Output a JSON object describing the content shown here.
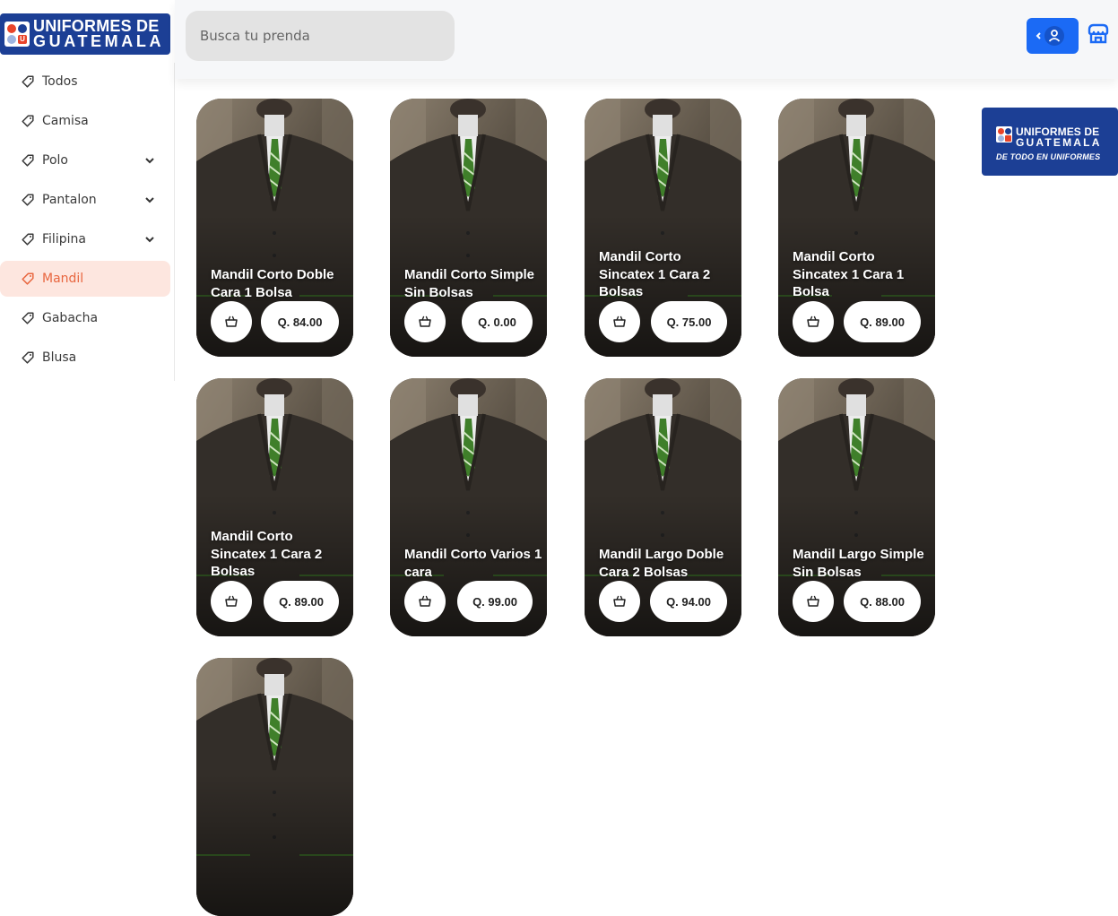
{
  "brand": {
    "line1": "UNIFORMES DE",
    "line2": "GUATEMALA",
    "mark_letter": "U"
  },
  "search": {
    "placeholder": "Busca tu prenda"
  },
  "sidebar": {
    "items": [
      {
        "label": "Todos",
        "expandable": false,
        "active": false
      },
      {
        "label": "Camisa",
        "expandable": false,
        "active": false
      },
      {
        "label": "Polo",
        "expandable": true,
        "active": false
      },
      {
        "label": "Pantalon",
        "expandable": true,
        "active": false
      },
      {
        "label": "Filipina",
        "expandable": true,
        "active": false
      },
      {
        "label": "Mandil",
        "expandable": false,
        "active": true
      },
      {
        "label": "Gabacha",
        "expandable": false,
        "active": false
      },
      {
        "label": "Blusa",
        "expandable": false,
        "active": false
      }
    ]
  },
  "header": {
    "user_icon": "user-icon",
    "store_icon": "store-icon"
  },
  "banner": {
    "line1": "UNIFORMES DE",
    "line2": "GUATEMALA",
    "tagline": "DE TODO EN UNIFORMES"
  },
  "products": [
    {
      "name": "Mandil Corto Doble Cara 1 Bolsa",
      "price": "Q. 84.00"
    },
    {
      "name": "Mandil Corto Simple Sin Bolsas",
      "price": "Q. 0.00"
    },
    {
      "name": "Mandil Corto Sincatex 1 Cara 2 Bolsas",
      "price": "Q. 75.00"
    },
    {
      "name": "Mandil Corto Sincatex 1 Cara 1 Bolsa",
      "price": "Q. 89.00"
    },
    {
      "name": "Mandil Corto Sincatex 1 Cara 2 Bolsas",
      "price": "Q. 89.00"
    },
    {
      "name": "Mandil Corto Varios 1 cara",
      "price": "Q. 99.00"
    },
    {
      "name": "Mandil Largo Doble Cara 2 Bolsas",
      "price": "Q. 94.00"
    },
    {
      "name": "Mandil Largo Simple Sin Bolsas",
      "price": "Q. 88.00"
    },
    {
      "name": "",
      "price": ""
    }
  ],
  "colors": {
    "brand_blue": "#1c3f95",
    "accent_orange": "#e8663f",
    "active_bg": "#fde6df",
    "button_blue": "#1b6af5"
  }
}
